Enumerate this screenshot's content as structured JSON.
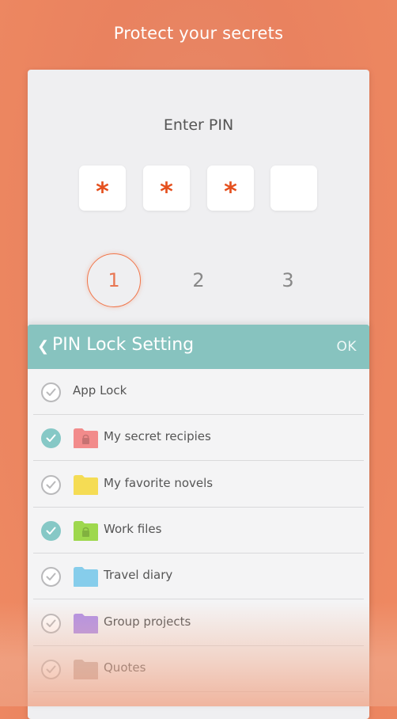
{
  "headline": "Protect your secrets",
  "pin": {
    "prompt": "Enter PIN",
    "digits": [
      "*",
      "*",
      "*",
      ""
    ]
  },
  "keypad": {
    "keys": [
      "1",
      "2",
      "3"
    ]
  },
  "settings": {
    "title": "PIN Lock Setting",
    "ok_label": "OK",
    "items": [
      {
        "label": "App Lock",
        "checked": false,
        "icon": "none"
      },
      {
        "label": "My secret recipies",
        "checked": true,
        "icon": "locked-folder-icon",
        "color": "#f28b8b"
      },
      {
        "label": "My favorite novels",
        "checked": false,
        "icon": "folder-icon",
        "color": "#f4dc55"
      },
      {
        "label": "Work files",
        "checked": true,
        "icon": "locked-folder-icon",
        "color": "#9ed84e"
      },
      {
        "label": "Travel diary",
        "checked": false,
        "icon": "folder-icon",
        "color": "#86cdeb"
      },
      {
        "label": "Group projects",
        "checked": false,
        "icon": "folder-icon",
        "color": "#b190e6"
      },
      {
        "label": "Quotes",
        "checked": false,
        "icon": "folder-icon",
        "color": "#c8b0a8"
      }
    ]
  },
  "colors": {
    "accent": "#e5501e",
    "header": "#87c3bf",
    "check_on": "#86c8c6"
  }
}
